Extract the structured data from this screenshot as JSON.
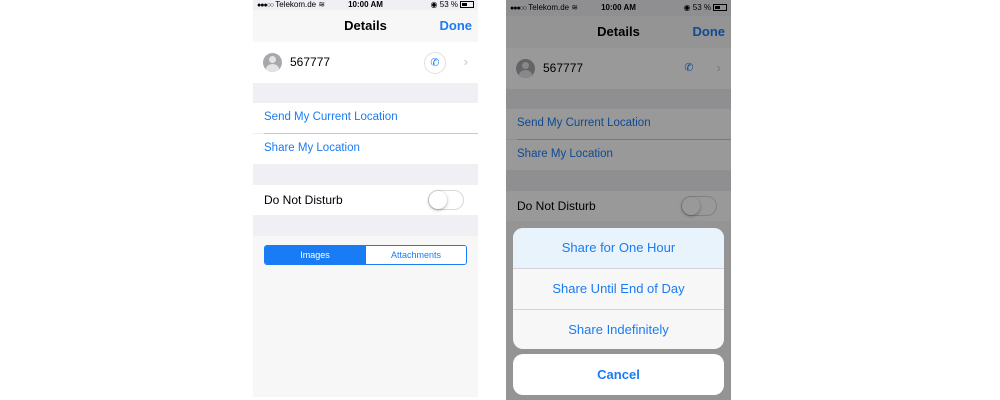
{
  "status_bar": {
    "signal": "●●●○○",
    "carrier": "Telekom.de",
    "time": "10:00 AM",
    "battery": "53 %"
  },
  "nav": {
    "title": "Details",
    "done_label": "Done"
  },
  "contact": {
    "name": "567777"
  },
  "location": {
    "send_label": "Send My Current Location",
    "share_label": "Share My Location"
  },
  "dnd": {
    "label": "Do Not Disturb",
    "enabled": false
  },
  "attachments_tabs": {
    "selected": "Images",
    "items": [
      "Images",
      "Attachments"
    ]
  },
  "action_sheet": {
    "options": [
      "Share for One Hour",
      "Share Until End of Day",
      "Share Indefinitely"
    ],
    "cancel_label": "Cancel"
  },
  "colors": {
    "accent": "#1a7cf4",
    "background": "#efeff4",
    "cell": "#ffffff"
  }
}
